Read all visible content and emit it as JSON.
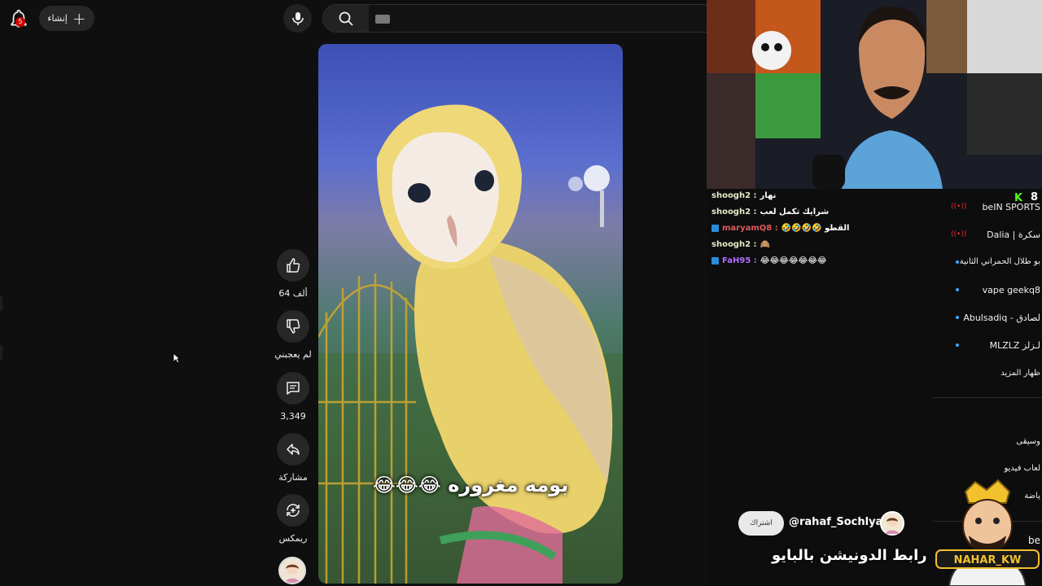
{
  "header": {
    "notification_count": "5",
    "create_label": "إنشاء"
  },
  "actions": {
    "like_count": "64 ألف",
    "dislike_label": "لم يعجبني",
    "comment_count": "3,349",
    "share_label": "مشاركة",
    "remix_label": "ريمكس"
  },
  "video": {
    "caption": "بومه مغروره 😂😂😂"
  },
  "chat": [
    {
      "user": "shoogh2 :",
      "message": "نهار",
      "badge": false,
      "user_color": "#e8e8c8"
    },
    {
      "user": "shoogh2 :",
      "message": "شرايك تكمل لعب",
      "badge": false,
      "user_color": "#e8e8c8"
    },
    {
      "user": "maryamQ8 :",
      "message": "القطو 🤣🤣🤣🤣",
      "badge": true,
      "user_color": "#e05a5a"
    },
    {
      "user": "shoogh2 :",
      "message": "🙈",
      "badge": false,
      "user_color": "#e8e8c8"
    },
    {
      "user": "FaH95 :",
      "message": "😂😂😂😂😂😂😂",
      "badge": true,
      "user_color": "#b36cff"
    }
  ],
  "stream": {
    "k_label": "K",
    "viewer_count": "8"
  },
  "sidebar_channels": [
    {
      "name": "beIN SPORTS",
      "live": true
    },
    {
      "name": "Dalia | سكرة",
      "live": true
    },
    {
      "name": "بو طلال الحمراني الثانية",
      "live": false
    },
    {
      "name": "vape geekq8",
      "live": false
    },
    {
      "name": "Abulsadiq - لصادق",
      "live": false
    },
    {
      "name": "MLZLZ لـزلز",
      "live": false
    }
  ],
  "sidebar_more": "ظهار المزيد",
  "sidebar_explore": [
    "وسيقى",
    "لعاب فيديو",
    "ياضة",
    "be"
  ],
  "overlay": {
    "subscribe_label": "اشتراك",
    "handle": "@rahaf_Sochlyat",
    "donation_text": "رابط الدونيشن بالبايو",
    "mascot_name": "NAHAR_KW"
  }
}
